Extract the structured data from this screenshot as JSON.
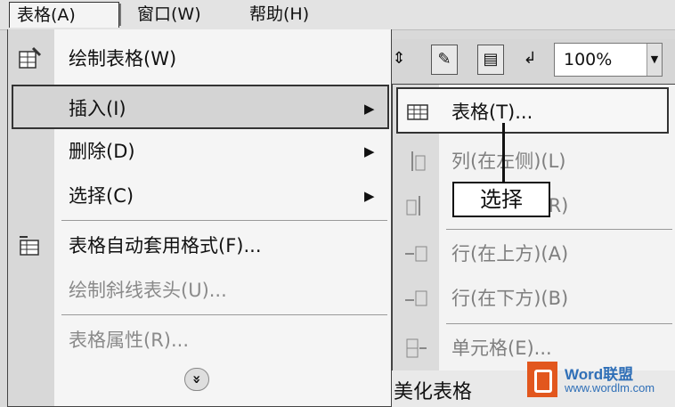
{
  "menubar": {
    "items": [
      {
        "label": "表格(A)"
      },
      {
        "label": "窗口(W)"
      },
      {
        "label": "帮助(H)"
      }
    ]
  },
  "toolbar": {
    "zoom_value": "100%"
  },
  "table_menu": {
    "items": [
      {
        "label": "绘制表格(W)"
      },
      {
        "label": "插入(I)"
      },
      {
        "label": "删除(D)"
      },
      {
        "label": "选择(C)"
      },
      {
        "label": "表格自动套用格式(F)..."
      },
      {
        "label": "绘制斜线表头(U)..."
      },
      {
        "label": "表格属性(R)..."
      }
    ],
    "expand_glyph": "»"
  },
  "insert_submenu": {
    "items": [
      {
        "label": "表格(T)..."
      },
      {
        "label": "列(在左侧)(L)"
      },
      {
        "label": "列(在右侧)(R)"
      },
      {
        "label": "行(在上方)(A)"
      },
      {
        "label": "行(在下方)(B)"
      },
      {
        "label": "单元格(E)..."
      }
    ]
  },
  "callout": {
    "text": "选择"
  },
  "document": {
    "partial_text": "美化表格"
  },
  "watermark": {
    "line1": "Word联盟",
    "line2": "www.wordlm.com"
  },
  "colors": {
    "watermark_blue": "#2f6fb7",
    "office_orange": "#e2571e"
  }
}
